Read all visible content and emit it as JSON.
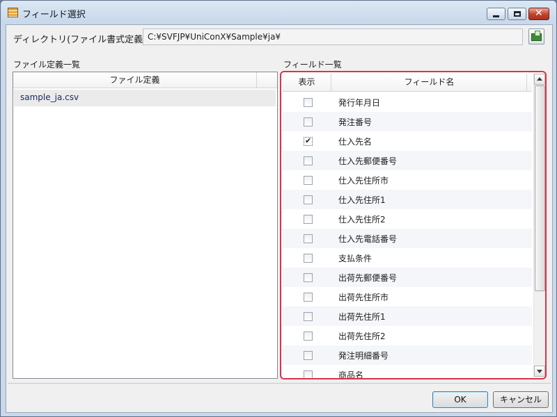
{
  "window": {
    "title": "フィールド選択"
  },
  "directory": {
    "label": "ディレクトリ(ファイル書式定義)",
    "value": "C:¥SVFJP¥UniConX¥Sample¥ja¥"
  },
  "file_list": {
    "section_label": "ファイル定義一覧",
    "column_header": "ファイル定義",
    "items": [
      "sample_ja.csv"
    ]
  },
  "field_list": {
    "section_label": "フィールド一覧",
    "col_show": "表示",
    "col_name": "フィールド名",
    "rows": [
      {
        "name": "発行年月日",
        "checked": false
      },
      {
        "name": "発注番号",
        "checked": false
      },
      {
        "name": "仕入先名",
        "checked": true
      },
      {
        "name": "仕入先郵便番号",
        "checked": false
      },
      {
        "name": "仕入先住所市",
        "checked": false
      },
      {
        "name": "仕入先住所1",
        "checked": false
      },
      {
        "name": "仕入先住所2",
        "checked": false
      },
      {
        "name": "仕入先電話番号",
        "checked": false
      },
      {
        "name": "支払条件",
        "checked": false
      },
      {
        "name": "出荷先郵便番号",
        "checked": false
      },
      {
        "name": "出荷先住所市",
        "checked": false
      },
      {
        "name": "出荷先住所1",
        "checked": false
      },
      {
        "name": "出荷先住所2",
        "checked": false
      },
      {
        "name": "発注明細番号",
        "checked": false
      },
      {
        "name": "商品名",
        "checked": false
      }
    ]
  },
  "buttons": {
    "ok": "OK",
    "cancel": "キャンセル"
  },
  "colors": {
    "highlight_border": "#d9324a",
    "title_bar": "#c9d9eb",
    "close_button": "#c2402a"
  }
}
